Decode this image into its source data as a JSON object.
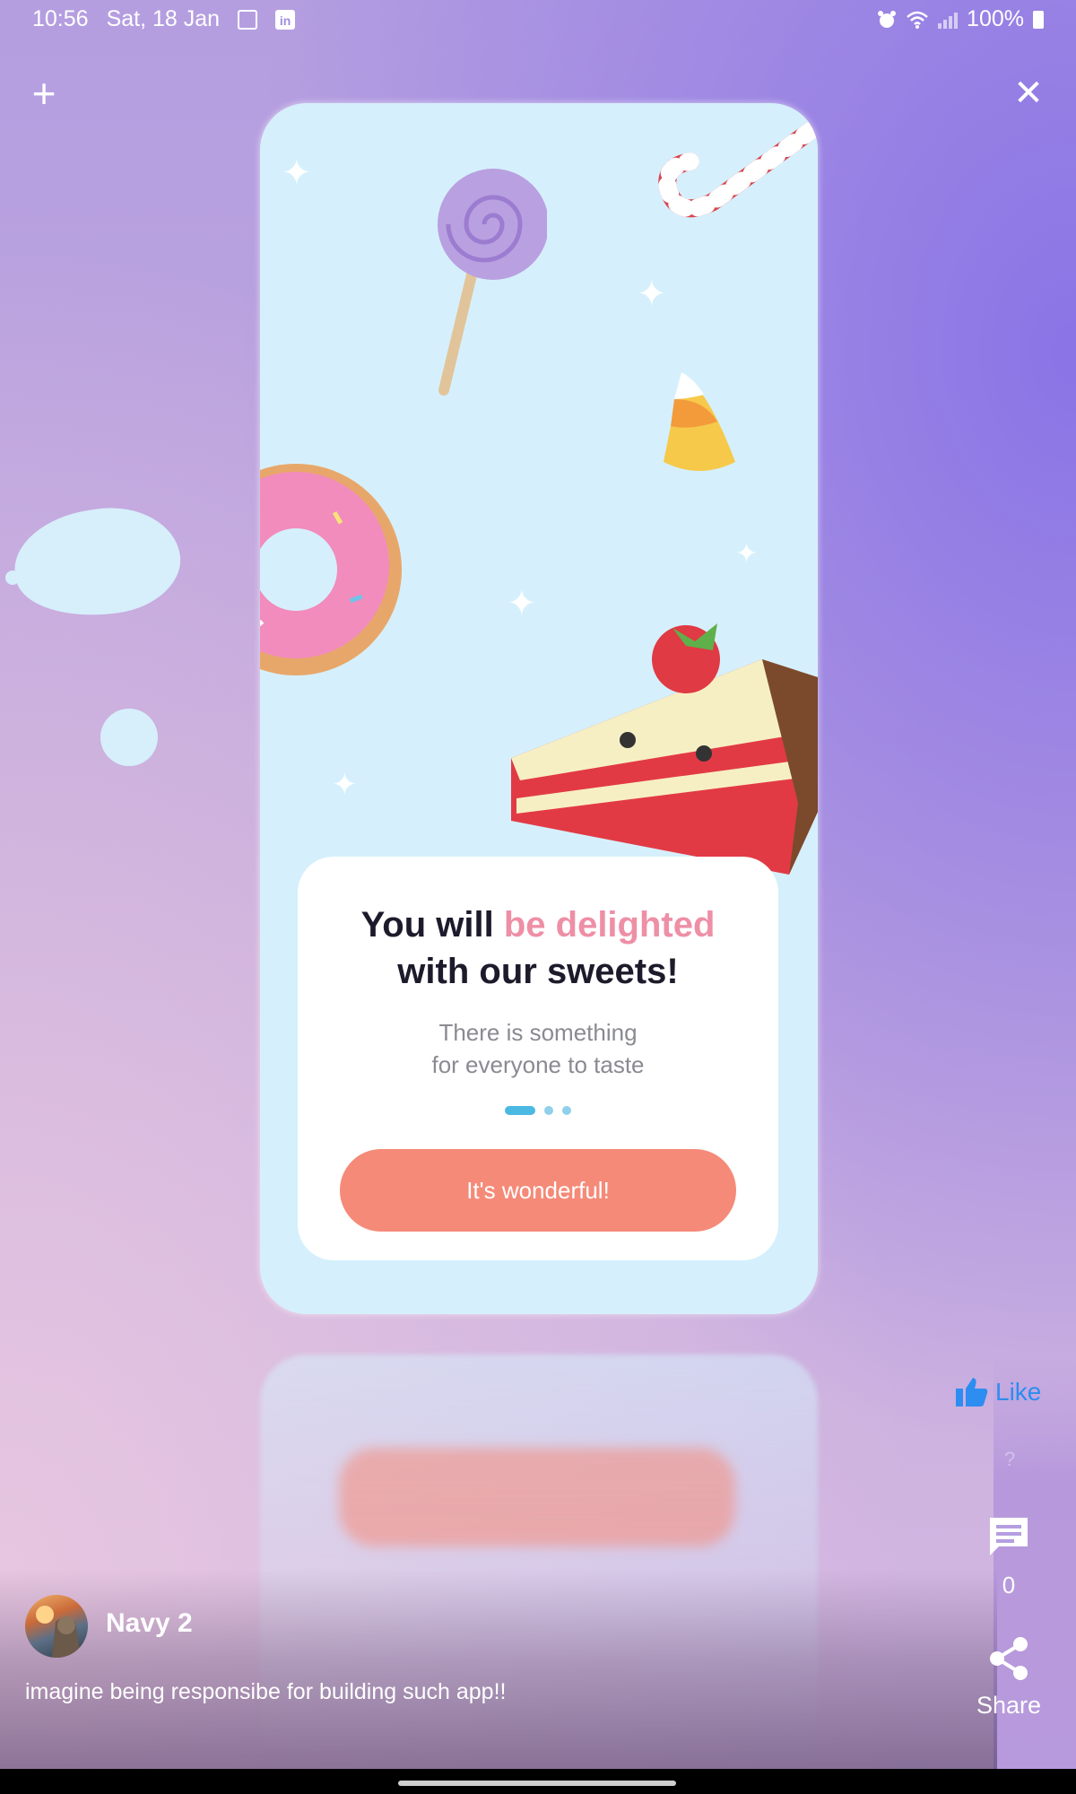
{
  "status_bar": {
    "time": "10:56",
    "date": "Sat, 18 Jan",
    "battery": "100%",
    "icons": [
      "gallery-icon",
      "linkedin-icon",
      "alarm-icon",
      "wifi-icon",
      "signal-icon",
      "battery-icon"
    ]
  },
  "top_bar": {
    "add_icon": "+",
    "close_icon": "✕"
  },
  "post_content": {
    "headline_part1": "You will",
    "headline_highlight": "be delighted",
    "headline_part2": "with our sweets!",
    "subline1": "There is something",
    "subline2": "for everyone to taste",
    "cta_label": "It's wonderful!",
    "accent_pink": "#ee8fa6",
    "cta_color": "#f58a78",
    "pagination_active_index": 0,
    "pagination_total": 3
  },
  "actions": {
    "like_label": "Like",
    "comment_count": "0",
    "share_label": "Share"
  },
  "author": {
    "name": "Navy 2",
    "caption": "imagine being responsibe for building such app!!"
  }
}
